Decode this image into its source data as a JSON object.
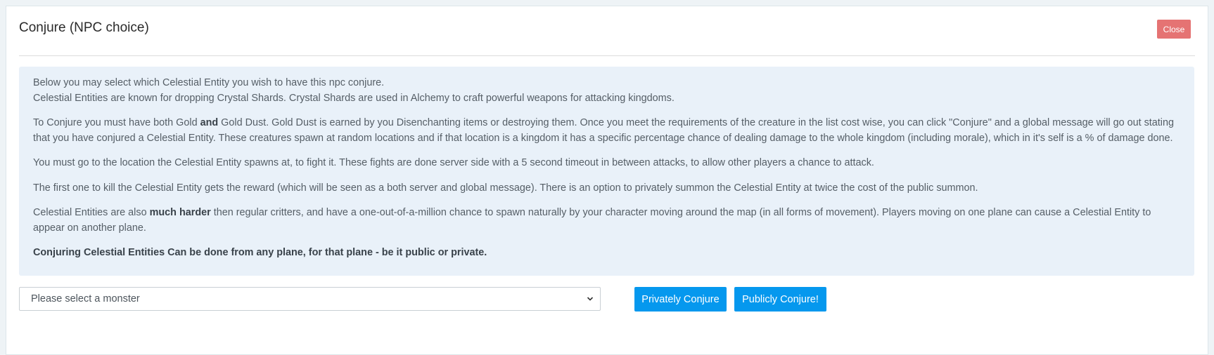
{
  "dialog": {
    "title": "Conjure (NPC choice)",
    "close_label": "Close"
  },
  "info": {
    "p1_line1": "Below you may select which Celestial Entity you wish to have this npc conjure.",
    "p1_line2": "Celestial Entities are known for dropping Crystal Shards. Crystal Shards are used in Alchemy to craft powerful weapons for attacking kingdoms.",
    "p2_a": "To Conjure you must have both Gold ",
    "p2_bold": "and",
    "p2_b": " Gold Dust. Gold Dust is earned by you Disenchanting items or destroying them. Once you meet the requirements of the creature in the list cost wise, you can click \"Conjure\" and a global message will go out stating that you have conjured a Celestial Entity. These creatures spawn at random locations and if that location is a kingdom it has a specific percentage chance of dealing damage to the whole kingdom (including morale), which in it's self is a % of damage done.",
    "p3": "You must go to the location the Celestial Entity spawns at, to fight it. These fights are done server side with a 5 second timeout in between attacks, to allow other players a chance to attack.",
    "p4": "The first one to kill the Celestial Entity gets the reward (which will be seen as a both server and global message). There is an option to privately summon the Celestial Entity at twice the cost of the public summon.",
    "p5_a": "Celestial Entities are also ",
    "p5_bold": "much harder",
    "p5_b": " then regular critters, and have a one-out-of-a-million chance to spawn naturally by your character moving around the map (in all forms of movement). Players moving on one plane can cause a Celestial Entity to appear on another plane.",
    "p6_bold": "Conjuring Celestial Entities Can be done from any plane, for that plane - be it public or private."
  },
  "controls": {
    "monster_select_value": "Please select a monster",
    "private_label": "Privately Conjure",
    "public_label": "Publicly Conjure!"
  },
  "icons": {
    "select_arrow": "chevron-down-icon"
  },
  "colors": {
    "close_button": "#e57373",
    "primary_button": "#0598ee",
    "info_background": "#e9f1f9"
  }
}
